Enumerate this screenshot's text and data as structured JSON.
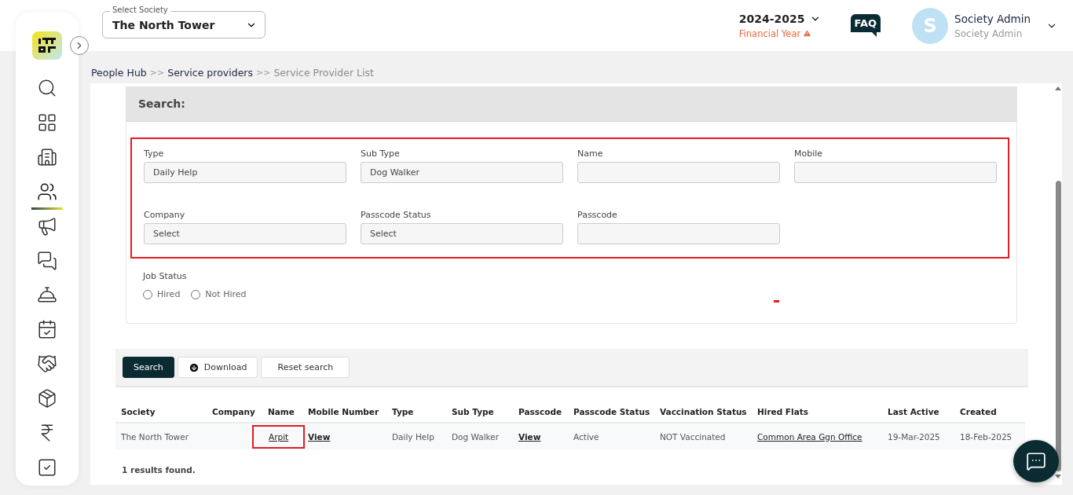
{
  "sidebar": {
    "items": [
      {
        "selected": false
      },
      {
        "selected": false
      },
      {
        "selected": false
      },
      {
        "selected": true
      },
      {
        "selected": false
      },
      {
        "selected": false
      },
      {
        "selected": false
      },
      {
        "selected": false
      },
      {
        "selected": false
      },
      {
        "selected": false
      },
      {
        "selected": false
      },
      {
        "selected": false
      }
    ]
  },
  "header": {
    "society_select": {
      "label": "Select Society",
      "value": "The North Tower"
    },
    "year": {
      "value": "2024-2025",
      "caption": "Financial Year"
    },
    "faq": "FAQ",
    "user": {
      "initial": "S",
      "name": "Society Admin",
      "role": "Society Admin"
    }
  },
  "breadcrumb": [
    {
      "label": "People Hub",
      "current": false
    },
    {
      "label": ">>",
      "kind": "sep"
    },
    {
      "label": "Service providers",
      "current": false
    },
    {
      "label": ">>",
      "kind": "sep"
    },
    {
      "label": "Service Provider List",
      "current": true
    }
  ],
  "search": {
    "title": "Search:",
    "fields": [
      {
        "label": "Type",
        "value": "Daily Help"
      },
      {
        "label": "Sub Type",
        "value": "Dog Walker"
      },
      {
        "label": "Name"
      },
      {
        "label": "Mobile"
      },
      {
        "label": "Company",
        "value": "Select"
      },
      {
        "label": "Passcode Status",
        "value": "Select"
      },
      {
        "label": "Passcode"
      }
    ],
    "job_status": {
      "label": "Job Status",
      "options": [
        {
          "label": "Hired",
          "selected": false
        },
        {
          "label": "Not Hired",
          "selected": false
        }
      ]
    }
  },
  "actions": [
    {
      "label": "Search",
      "kind": "primary"
    },
    {
      "label": "Download",
      "kind": "download"
    },
    {
      "label": "Reset search",
      "kind": "plain"
    }
  ],
  "table": {
    "columns": [
      "Society",
      "Company",
      "Name",
      "Mobile Number",
      "Type",
      "Sub Type",
      "Passcode",
      "Passcode Status",
      "Vaccination Status",
      "Hired Flats",
      "Last Active",
      "Created"
    ],
    "rows": [
      {
        "cells": [
          {
            "text": "The North Tower",
            "kind": "text"
          },
          {
            "kind": "blank"
          },
          {
            "text": "Arpit",
            "kind": "link",
            "highlighted": true
          },
          {
            "text": "View",
            "kind": "strong-link"
          },
          {
            "text": "Daily Help",
            "kind": "text"
          },
          {
            "text": "Dog Walker",
            "kind": "text"
          },
          {
            "text": "View",
            "kind": "strong-link"
          },
          {
            "text": "Active",
            "kind": "text"
          },
          {
            "text": "NOT Vaccinated",
            "kind": "text"
          },
          {
            "text": "Common Area Ggn Office",
            "kind": "link"
          },
          {
            "text": "19-Mar-2025",
            "kind": "text"
          },
          {
            "text": "18-Feb-2025",
            "kind": "text"
          }
        ]
      }
    ]
  },
  "results": "1 results found."
}
